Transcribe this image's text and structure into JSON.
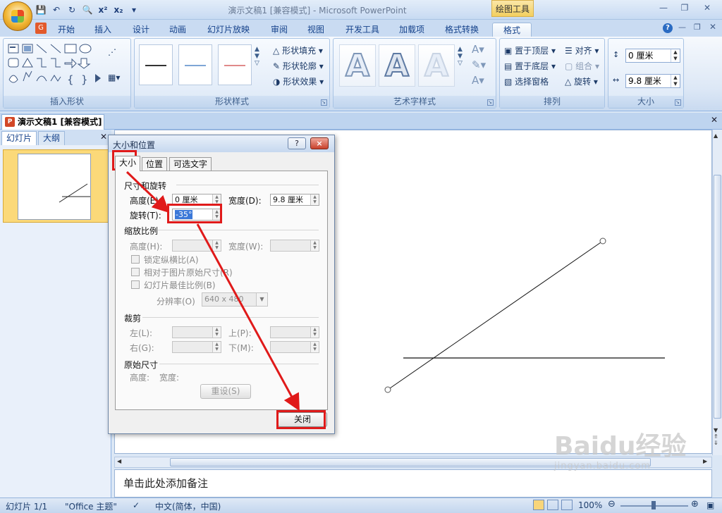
{
  "app": {
    "title": "演示文稿1 [兼容模式] - Microsoft PowerPoint",
    "context_tab_title": "绘图工具"
  },
  "qat": {
    "icons": [
      "save-icon",
      "undo-icon",
      "redo-icon",
      "print-preview-icon",
      "superscript-icon",
      "subscript-icon",
      "customize-qat-icon"
    ]
  },
  "tabs": [
    {
      "label": "开始"
    },
    {
      "label": "插入"
    },
    {
      "label": "设计"
    },
    {
      "label": "动画"
    },
    {
      "label": "幻灯片放映"
    },
    {
      "label": "审阅"
    },
    {
      "label": "视图"
    },
    {
      "label": "开发工具"
    },
    {
      "label": "加载项"
    },
    {
      "label": "格式转换"
    },
    {
      "label": "格式"
    }
  ],
  "active_tab": "格式",
  "ribbon": {
    "groups": {
      "insert_shapes": "插入形状",
      "shape_styles": "形状样式",
      "wordart_styles": "艺术字样式",
      "arrange": "排列",
      "size": "大小"
    },
    "shape_fill": "形状填充",
    "shape_outline": "形状轮廓",
    "shape_effects": "形状效果",
    "bring_to_front": "置于顶层",
    "send_to_back": "置于底层",
    "selection_pane": "选择窗格",
    "align": "对齐",
    "group": "组合",
    "rotate": "旋转",
    "height_value": "0 厘米",
    "width_value": "9.8 厘米"
  },
  "document_tab": {
    "label": "演示文稿1 [兼容模式]"
  },
  "left_pane": {
    "tabs": [
      "幻灯片",
      "大纲"
    ],
    "slide_number": "1"
  },
  "notes": {
    "placeholder": "单击此处添加备注"
  },
  "status": {
    "slide": "幻灯片 1/1",
    "theme": "\"Office 主题\"",
    "language": "中文(简体，中国)",
    "zoom": "100%"
  },
  "dialog": {
    "title": "大小和位置",
    "tabs": [
      "大小",
      "位置",
      "可选文字"
    ],
    "active_tab": "大小",
    "sections": {
      "size_rotate": "尺寸和旋转",
      "scale": "缩放比例",
      "crop": "裁剪",
      "original": "原始尺寸"
    },
    "labels": {
      "height": "高度(E):",
      "width": "宽度(D):",
      "rotation": "旋转(T):",
      "scale_height": "高度(H):",
      "scale_width": "宽度(W):",
      "lock_aspect": "锁定纵横比(A)",
      "relative_original": "相对于图片原始尺寸(R)",
      "best_scale": "幻灯片最佳比例(B)",
      "resolution": "分辨率(O)",
      "left": "左(L):",
      "right": "右(G):",
      "top": "上(P):",
      "bottom": "下(M):",
      "orig_height": "高度:",
      "orig_width": "宽度:"
    },
    "values": {
      "height": "0 厘米",
      "width": "9.8 厘米",
      "rotation": "-35°",
      "resolution": "640 x 480"
    },
    "reset_button": "重设(S)",
    "close_button": "关闭",
    "help_button": "?",
    "close_x": "×"
  },
  "watermark": {
    "text": "Baidu经验",
    "sub": "jingyan.baidu.com"
  },
  "colors": {
    "annotation": "#e01a1a",
    "ribbon_bg": "#dbe7f5",
    "thumb_highlight": "#fbd979"
  }
}
